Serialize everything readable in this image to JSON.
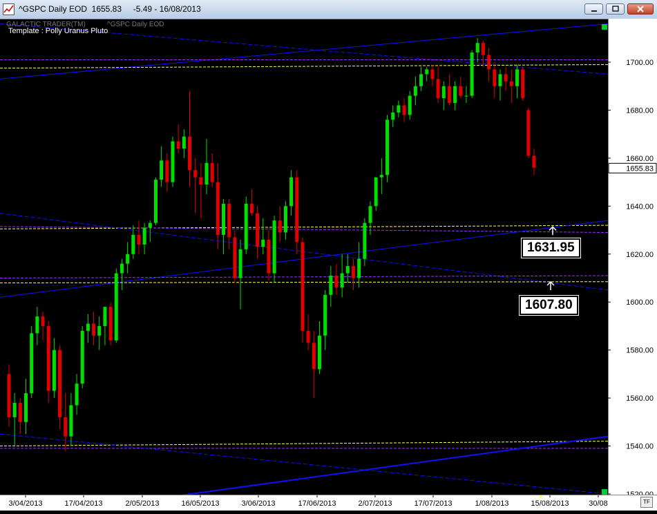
{
  "window": {
    "title": "^GSPC Daily EOD  1655.83     -5.49 - 16/08/2013"
  },
  "header": {
    "brand": "GALACTIC TRADER(TM)",
    "series": "^GSPC Daily EOD",
    "template": "Template : Polly Uranus Pluto"
  },
  "colors": {
    "up": "#00e000",
    "down": "#e00000",
    "blue_line": "#1010ff",
    "purple_line": "#9b30ff",
    "yellow_line": "#ffff66"
  },
  "labels": {
    "level_1": "1631.95",
    "level_2": "1607.80",
    "last_price": "1655.83",
    "tf": "TF"
  },
  "chart_data": {
    "type": "candlestick",
    "ylim": [
      1520,
      1715
    ],
    "yticks": [
      "1700.00",
      "1680.00",
      "1660.00",
      "1640.00",
      "1620.00",
      "1600.00",
      "1580.00",
      "1560.00",
      "1540.00",
      "1520.00"
    ],
    "xticks": [
      "3/04/2013",
      "17/04/2013",
      "2/05/2013",
      "16/05/2013",
      "3/06/2013",
      "17/06/2013",
      "2/07/2013",
      "17/07/2013",
      "1/08/2013",
      "15/08/2013",
      "30/08"
    ],
    "last_price": 1655.83,
    "candles": [
      {
        "o": 1570,
        "h": 1574,
        "l": 1548,
        "c": 1552
      },
      {
        "o": 1552,
        "h": 1562,
        "l": 1540,
        "c": 1558
      },
      {
        "o": 1558,
        "h": 1560,
        "l": 1545,
        "c": 1550
      },
      {
        "o": 1550,
        "h": 1568,
        "l": 1545,
        "c": 1562
      },
      {
        "o": 1562,
        "h": 1590,
        "l": 1560,
        "c": 1587
      },
      {
        "o": 1587,
        "h": 1598,
        "l": 1582,
        "c": 1594
      },
      {
        "o": 1594,
        "h": 1596,
        "l": 1584,
        "c": 1590
      },
      {
        "o": 1590,
        "h": 1592,
        "l": 1558,
        "c": 1563
      },
      {
        "o": 1563,
        "h": 1585,
        "l": 1560,
        "c": 1580
      },
      {
        "o": 1580,
        "h": 1582,
        "l": 1547,
        "c": 1552
      },
      {
        "o": 1552,
        "h": 1562,
        "l": 1538,
        "c": 1544
      },
      {
        "o": 1544,
        "h": 1562,
        "l": 1540,
        "c": 1557
      },
      {
        "o": 1557,
        "h": 1570,
        "l": 1553,
        "c": 1566
      },
      {
        "o": 1566,
        "h": 1590,
        "l": 1564,
        "c": 1588
      },
      {
        "o": 1588,
        "h": 1595,
        "l": 1583,
        "c": 1591
      },
      {
        "o": 1591,
        "h": 1596,
        "l": 1582,
        "c": 1586
      },
      {
        "o": 1586,
        "h": 1594,
        "l": 1580,
        "c": 1590
      },
      {
        "o": 1590,
        "h": 1598,
        "l": 1582,
        "c": 1598
      },
      {
        "o": 1598,
        "h": 1600,
        "l": 1582,
        "c": 1584
      },
      {
        "o": 1584,
        "h": 1614,
        "l": 1583,
        "c": 1612
      },
      {
        "o": 1612,
        "h": 1618,
        "l": 1605,
        "c": 1616
      },
      {
        "o": 1616,
        "h": 1625,
        "l": 1612,
        "c": 1620
      },
      {
        "o": 1620,
        "h": 1632,
        "l": 1618,
        "c": 1628
      },
      {
        "o": 1628,
        "h": 1634,
        "l": 1620,
        "c": 1624
      },
      {
        "o": 1624,
        "h": 1633,
        "l": 1620,
        "c": 1631
      },
      {
        "o": 1631,
        "h": 1634,
        "l": 1625,
        "c": 1633
      },
      {
        "o": 1633,
        "h": 1652,
        "l": 1632,
        "c": 1651
      },
      {
        "o": 1651,
        "h": 1665,
        "l": 1648,
        "c": 1659
      },
      {
        "o": 1659,
        "h": 1662,
        "l": 1646,
        "c": 1650
      },
      {
        "o": 1650,
        "h": 1669,
        "l": 1648,
        "c": 1667
      },
      {
        "o": 1667,
        "h": 1674,
        "l": 1662,
        "c": 1664
      },
      {
        "o": 1664,
        "h": 1672,
        "l": 1660,
        "c": 1669
      },
      {
        "o": 1669,
        "h": 1688,
        "l": 1648,
        "c": 1655
      },
      {
        "o": 1655,
        "h": 1660,
        "l": 1637,
        "c": 1652
      },
      {
        "o": 1652,
        "h": 1658,
        "l": 1635,
        "c": 1649
      },
      {
        "o": 1649,
        "h": 1668,
        "l": 1645,
        "c": 1658
      },
      {
        "o": 1658,
        "h": 1662,
        "l": 1648,
        "c": 1650
      },
      {
        "o": 1650,
        "h": 1658,
        "l": 1622,
        "c": 1628
      },
      {
        "o": 1628,
        "h": 1643,
        "l": 1620,
        "c": 1641
      },
      {
        "o": 1641,
        "h": 1643,
        "l": 1622,
        "c": 1627
      },
      {
        "o": 1627,
        "h": 1630,
        "l": 1608,
        "c": 1610
      },
      {
        "o": 1610,
        "h": 1626,
        "l": 1597,
        "c": 1622
      },
      {
        "o": 1622,
        "h": 1644,
        "l": 1620,
        "c": 1641
      },
      {
        "o": 1641,
        "h": 1647,
        "l": 1636,
        "c": 1637
      },
      {
        "o": 1637,
        "h": 1640,
        "l": 1618,
        "c": 1623
      },
      {
        "o": 1623,
        "h": 1635,
        "l": 1620,
        "c": 1626
      },
      {
        "o": 1626,
        "h": 1630,
        "l": 1609,
        "c": 1612
      },
      {
        "o": 1612,
        "h": 1636,
        "l": 1608,
        "c": 1634
      },
      {
        "o": 1634,
        "h": 1640,
        "l": 1625,
        "c": 1629
      },
      {
        "o": 1629,
        "h": 1642,
        "l": 1626,
        "c": 1640
      },
      {
        "o": 1640,
        "h": 1655,
        "l": 1636,
        "c": 1652
      },
      {
        "o": 1652,
        "h": 1655,
        "l": 1620,
        "c": 1625
      },
      {
        "o": 1625,
        "h": 1627,
        "l": 1583,
        "c": 1588
      },
      {
        "o": 1588,
        "h": 1595,
        "l": 1580,
        "c": 1583
      },
      {
        "o": 1583,
        "h": 1588,
        "l": 1560,
        "c": 1572
      },
      {
        "o": 1572,
        "h": 1592,
        "l": 1570,
        "c": 1586
      },
      {
        "o": 1586,
        "h": 1605,
        "l": 1580,
        "c": 1603
      },
      {
        "o": 1603,
        "h": 1615,
        "l": 1598,
        "c": 1611
      },
      {
        "o": 1611,
        "h": 1616,
        "l": 1603,
        "c": 1606
      },
      {
        "o": 1606,
        "h": 1620,
        "l": 1602,
        "c": 1612
      },
      {
        "o": 1612,
        "h": 1620,
        "l": 1608,
        "c": 1615
      },
      {
        "o": 1615,
        "h": 1618,
        "l": 1605,
        "c": 1610
      },
      {
        "o": 1610,
        "h": 1625,
        "l": 1606,
        "c": 1618
      },
      {
        "o": 1618,
        "h": 1635,
        "l": 1615,
        "c": 1633
      },
      {
        "o": 1633,
        "h": 1642,
        "l": 1628,
        "c": 1640
      },
      {
        "o": 1640,
        "h": 1652,
        "l": 1638,
        "c": 1652
      },
      {
        "o": 1652,
        "h": 1660,
        "l": 1645,
        "c": 1653
      },
      {
        "o": 1653,
        "h": 1678,
        "l": 1650,
        "c": 1676
      },
      {
        "o": 1676,
        "h": 1682,
        "l": 1673,
        "c": 1679
      },
      {
        "o": 1679,
        "h": 1684,
        "l": 1677,
        "c": 1682
      },
      {
        "o": 1682,
        "h": 1685,
        "l": 1675,
        "c": 1678
      },
      {
        "o": 1678,
        "h": 1688,
        "l": 1676,
        "c": 1686
      },
      {
        "o": 1686,
        "h": 1694,
        "l": 1682,
        "c": 1690
      },
      {
        "o": 1690,
        "h": 1698,
        "l": 1688,
        "c": 1695
      },
      {
        "o": 1695,
        "h": 1698,
        "l": 1692,
        "c": 1697
      },
      {
        "o": 1697,
        "h": 1699,
        "l": 1690,
        "c": 1693
      },
      {
        "o": 1693,
        "h": 1698,
        "l": 1683,
        "c": 1685
      },
      {
        "o": 1685,
        "h": 1692,
        "l": 1680,
        "c": 1690
      },
      {
        "o": 1690,
        "h": 1695,
        "l": 1682,
        "c": 1683
      },
      {
        "o": 1683,
        "h": 1692,
        "l": 1680,
        "c": 1690
      },
      {
        "o": 1690,
        "h": 1694,
        "l": 1685,
        "c": 1686
      },
      {
        "o": 1686,
        "h": 1690,
        "l": 1683,
        "c": 1686
      },
      {
        "o": 1686,
        "h": 1705,
        "l": 1685,
        "c": 1704
      },
      {
        "o": 1704,
        "h": 1710,
        "l": 1700,
        "c": 1708
      },
      {
        "o": 1708,
        "h": 1709,
        "l": 1698,
        "c": 1703
      },
      {
        "o": 1703,
        "h": 1706,
        "l": 1692,
        "c": 1697
      },
      {
        "o": 1697,
        "h": 1700,
        "l": 1685,
        "c": 1690
      },
      {
        "o": 1690,
        "h": 1697,
        "l": 1684,
        "c": 1695
      },
      {
        "o": 1695,
        "h": 1698,
        "l": 1688,
        "c": 1692
      },
      {
        "o": 1692,
        "h": 1697,
        "l": 1683,
        "c": 1690
      },
      {
        "o": 1690,
        "h": 1699,
        "l": 1685,
        "c": 1697
      },
      {
        "o": 1697,
        "h": 1698,
        "l": 1684,
        "c": 1685
      },
      {
        "o": 1680,
        "h": 1681,
        "l": 1660,
        "c": 1661
      },
      {
        "o": 1661,
        "h": 1664,
        "l": 1653,
        "c": 1656
      }
    ],
    "levels": [
      {
        "name": "blue upper bound",
        "color": "blue",
        "y": [
          1693,
          1716
        ]
      },
      {
        "name": "blue upper descending",
        "color": "blue",
        "y": [
          1716,
          1695
        ]
      },
      {
        "name": "purple top",
        "color": "purple",
        "y": [
          1701,
          1701
        ]
      },
      {
        "name": "yellow top",
        "color": "yellow",
        "y": [
          1697.5,
          1699
        ]
      },
      {
        "name": "yellow middle",
        "color": "yellow",
        "y": [
          1630.5,
          1632
        ]
      },
      {
        "name": "purple middle",
        "color": "purple",
        "y": [
          1631.5,
          1629
        ]
      },
      {
        "name": "blue middle ascending",
        "color": "blue",
        "y": [
          1602,
          1634
        ]
      },
      {
        "name": "blue middle descending",
        "color": "blue",
        "y": [
          1637,
          1605
        ]
      },
      {
        "name": "purple lower",
        "color": "purple",
        "y": [
          1610,
          1611
        ]
      },
      {
        "name": "yellow lower",
        "color": "yellow",
        "y": [
          1608,
          1608.5
        ]
      },
      {
        "name": "yellow bottom",
        "color": "yellow",
        "y": [
          1540,
          1542
        ]
      },
      {
        "name": "purple bottom",
        "color": "purple",
        "y": [
          1539,
          1539
        ]
      },
      {
        "name": "blue bottom ascending",
        "color": "blue",
        "y": [
          1509,
          1544
        ]
      },
      {
        "name": "blue bottom descending",
        "color": "blue",
        "y": [
          1545,
          1520
        ]
      }
    ]
  }
}
